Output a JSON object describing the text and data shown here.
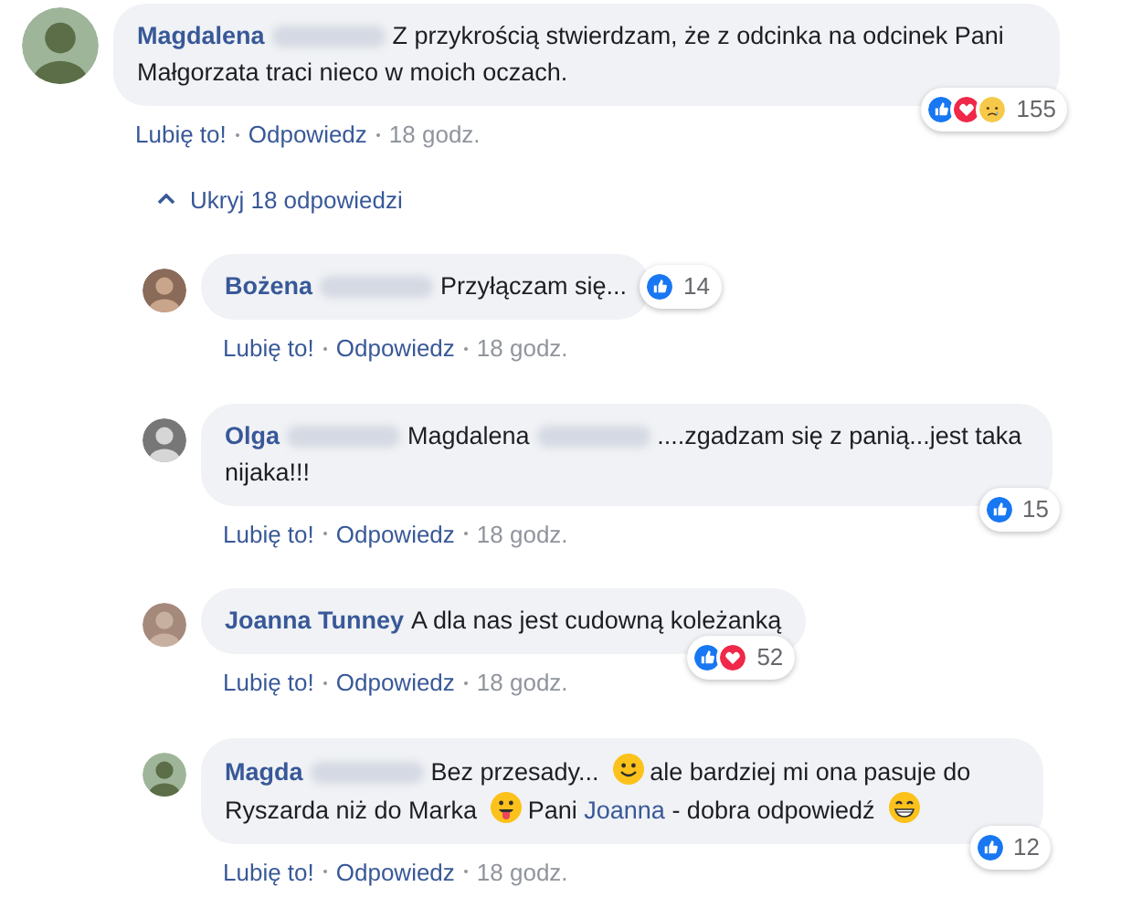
{
  "comments": [
    {
      "author": "Magdalena",
      "body": [
        {
          "kind": "blur"
        },
        {
          "kind": "text",
          "text": "Z przykrością stwierdzam, że z odcinka na odcinek Pani Małgorzata traci nieco w moich oczach."
        }
      ],
      "reactions": [
        {
          "kind": "like"
        },
        {
          "kind": "love"
        },
        {
          "kind": "sad"
        }
      ],
      "reaction_count": "155",
      "actions": [
        "Lubię to!",
        "Odpowiedz"
      ],
      "time": "18 godz.",
      "reply": false
    },
    {
      "kind": "toggle",
      "label": "Ukryj 18 odpowiedzi",
      "expanded": true
    },
    {
      "author": "Bożena",
      "body": [
        {
          "kind": "blur"
        },
        {
          "kind": "text",
          "text": "Przyłączam się..."
        }
      ],
      "reactions": [
        {
          "kind": "like"
        }
      ],
      "reaction_count": "14",
      "actions": [
        "Lubię to!",
        "Odpowiedz"
      ],
      "time": "18 godz.",
      "reply": true
    },
    {
      "author": "Olga",
      "body": [
        {
          "kind": "blur"
        },
        {
          "kind": "text",
          "text": "Magdalena"
        },
        {
          "kind": "blur"
        },
        {
          "kind": "text",
          "text": "....zgadzam się z panią...jest taka nijaka!!!"
        }
      ],
      "reactions": [
        {
          "kind": "like"
        }
      ],
      "reaction_count": "15",
      "actions": [
        "Lubię to!",
        "Odpowiedz"
      ],
      "time": "18 godz.",
      "reply": true
    },
    {
      "author": "Joanna Tunney",
      "body": [
        {
          "kind": "text",
          "text": "A dla nas jest cudowną koleżanką"
        }
      ],
      "reactions": [
        {
          "kind": "like"
        },
        {
          "kind": "love"
        }
      ],
      "reaction_count": "52",
      "actions": [
        "Lubię to!",
        "Odpowiedz"
      ],
      "time": "18 godz.",
      "reply": true
    },
    {
      "author": "Magda",
      "body": [
        {
          "kind": "blur"
        },
        {
          "kind": "text",
          "text": "Bez przesady..."
        },
        {
          "kind": "smile"
        },
        {
          "kind": "text",
          "text": "ale bardziej mi ona pasuje do Ryszarda niż do Marka"
        },
        {
          "kind": "tongue"
        },
        {
          "kind": "text",
          "text": "Pani"
        },
        {
          "kind": "mention",
          "text": "Joanna"
        },
        {
          "kind": "text",
          "text": "- dobra odpowiedź"
        },
        {
          "kind": "grin"
        }
      ],
      "reactions": [
        {
          "kind": "like"
        }
      ],
      "reaction_count": "12",
      "actions": [
        "Lubię to!",
        "Odpowiedz"
      ],
      "time": "18 godz.",
      "reply": true
    }
  ]
}
